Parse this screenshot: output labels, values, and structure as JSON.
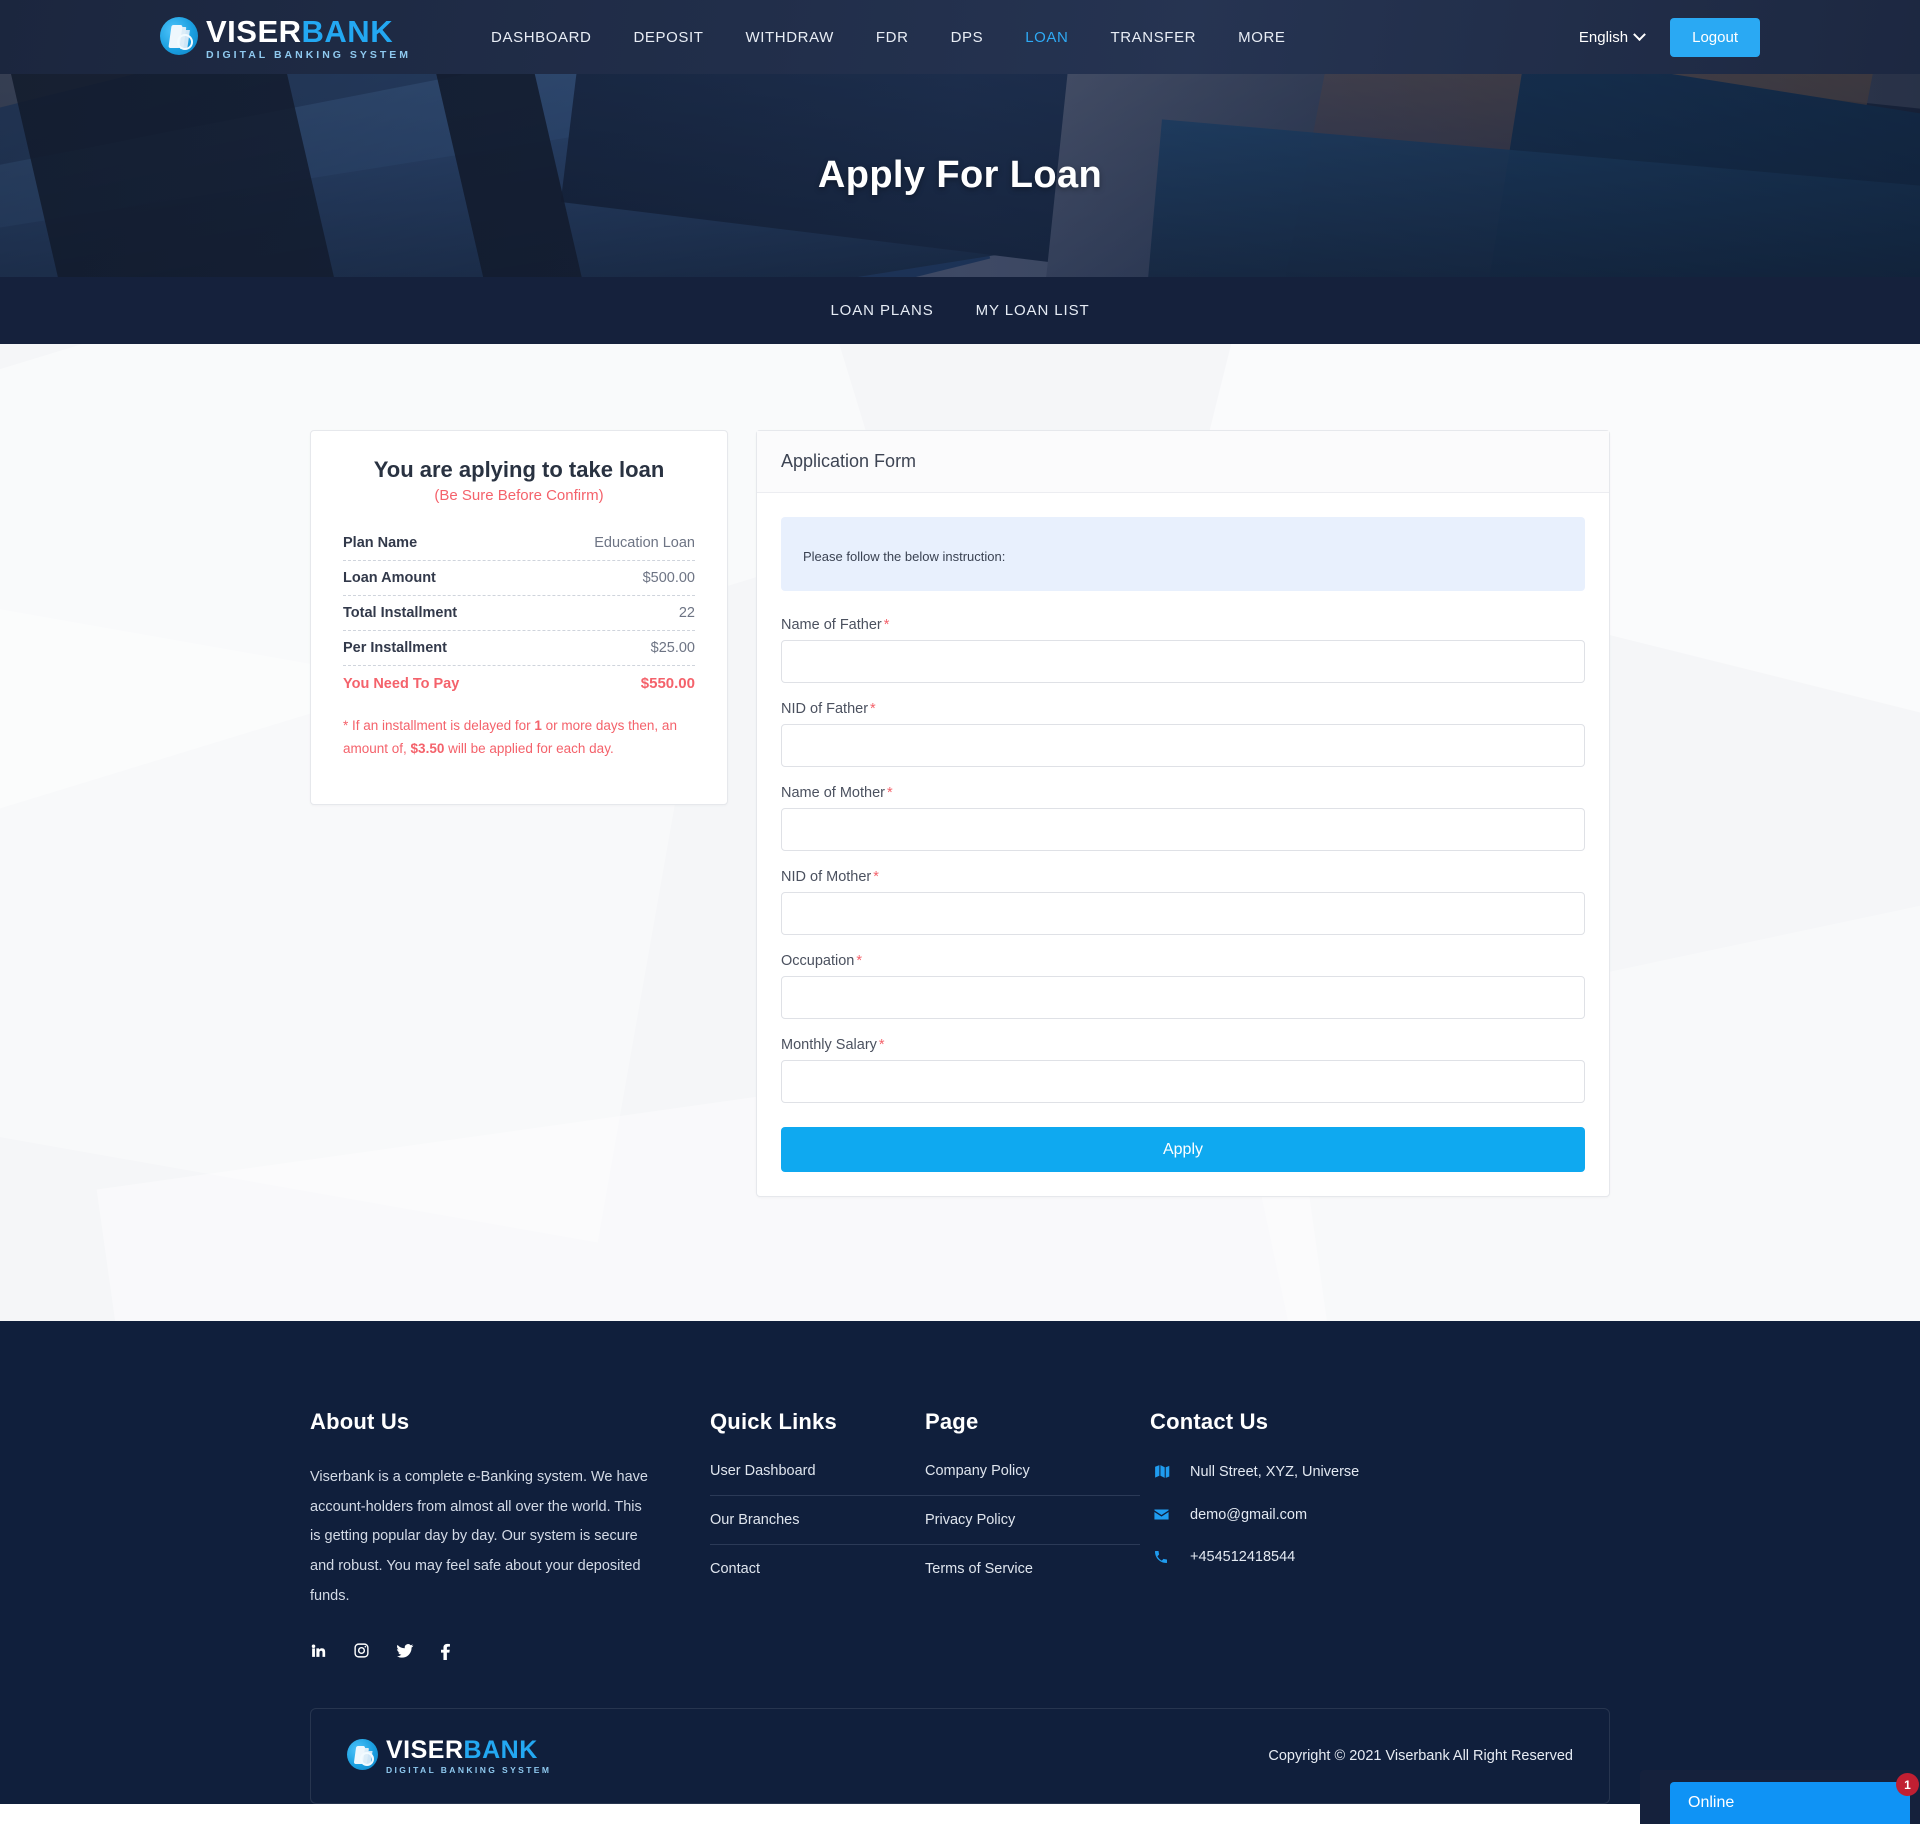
{
  "brand": {
    "word1": "VISER",
    "word2": "BANK",
    "tagline": "DIGITAL BANKING SYSTEM"
  },
  "topnav": {
    "links": [
      {
        "label": "DASHBOARD",
        "active": false
      },
      {
        "label": "DEPOSIT",
        "active": false
      },
      {
        "label": "WITHDRAW",
        "active": false
      },
      {
        "label": "FDR",
        "active": false
      },
      {
        "label": "DPS",
        "active": false
      },
      {
        "label": "LOAN",
        "active": true
      },
      {
        "label": "TRANSFER",
        "active": false
      },
      {
        "label": "MORE",
        "active": false
      }
    ],
    "language": "English",
    "logout_label": "Logout"
  },
  "banner": {
    "title": "Apply For Loan"
  },
  "subnav": {
    "items": [
      "LOAN PLANS",
      "MY LOAN LIST"
    ]
  },
  "summary": {
    "title": "You are aplying to take loan",
    "subtitle": "(Be Sure Before Confirm)",
    "rows": [
      {
        "key": "Plan Name",
        "value": "Education Loan"
      },
      {
        "key": "Loan Amount",
        "value": "$500.00"
      },
      {
        "key": "Total Installment",
        "value": "22"
      },
      {
        "key": "Per Installment",
        "value": "$25.00"
      }
    ],
    "total_key": "You Need To Pay",
    "total_value": "$550.00",
    "note_prefix": "* If an installment is delayed for ",
    "note_days": "1",
    "note_mid": " or more days then, an amount of, ",
    "note_amount": "$3.50",
    "note_suffix": " will be applied for each day."
  },
  "form": {
    "heading": "Application Form",
    "instruction": "Please follow the below instruction",
    "instruction_colon": ":",
    "fields": [
      {
        "label": "Name of Father",
        "required": "*",
        "value": "",
        "placeholder": ""
      },
      {
        "label": "NID of Father",
        "required": "*",
        "value": "",
        "placeholder": ""
      },
      {
        "label": "Name of Mother",
        "required": "*",
        "value": "",
        "placeholder": ""
      },
      {
        "label": "NID of Mother",
        "required": "*",
        "value": "",
        "placeholder": ""
      },
      {
        "label": "Occupation",
        "required": "*",
        "value": "",
        "placeholder": ""
      },
      {
        "label": "Monthly Salary",
        "required": "*",
        "value": "",
        "placeholder": ""
      }
    ],
    "submit_label": "Apply"
  },
  "footer": {
    "about": {
      "heading": "About Us",
      "text": "Viserbank is a complete e-Banking system. We have account-holders from almost all over the world. This is getting popular day by day. Our system is secure and robust. You may feel safe about your deposited funds.",
      "socials": [
        "linkedin-icon",
        "instagram-icon",
        "twitter-icon",
        "facebook-icon"
      ]
    },
    "quick": {
      "heading": "Quick Links",
      "links": [
        "User Dashboard",
        "Our Branches",
        "Contact"
      ]
    },
    "page": {
      "heading": "Page",
      "links": [
        "Company Policy",
        "Privacy Policy",
        "Terms of Service"
      ]
    },
    "contact": {
      "heading": "Contact Us",
      "rows": [
        {
          "icon": "map-icon",
          "text": "Null Street, XYZ, Universe"
        },
        {
          "icon": "envelope-icon",
          "text": "demo@gmail.com"
        },
        {
          "icon": "phone-icon",
          "text": "+454512418544"
        }
      ]
    },
    "copyright": "Copyright © 2021 Viserbank All Right Reserved"
  },
  "chat": {
    "label": "Online",
    "badge": "1"
  },
  "colors": {
    "accent": "#2aa9f3",
    "danger": "#f4626b",
    "navy": "#15213c",
    "footer_bg": "#101f3c",
    "instruction_bg": "#e8f0fd"
  }
}
